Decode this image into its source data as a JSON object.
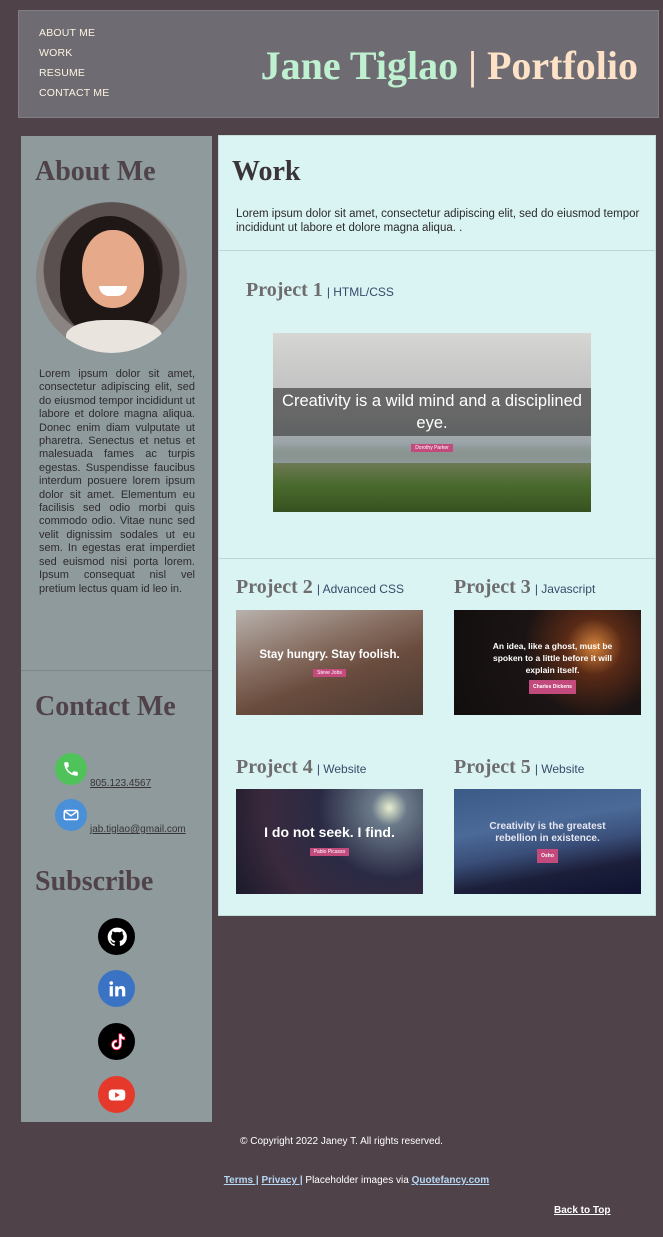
{
  "nav": {
    "items": [
      "ABOUT ME",
      "WORK",
      "RESUME",
      "CONTACT ME"
    ]
  },
  "brand": {
    "name": "Jane Tiglao",
    "separator": " | ",
    "suffix": "Portfolio"
  },
  "sidebar": {
    "about_heading": "About Me",
    "about_text": "Lorem ipsum dolor sit amet, consectetur adipiscing elit, sed do eiusmod tempor incididunt ut labore et dolore magna aliqua. Donec enim diam vulputate ut pharetra. Senectus et netus et malesuada fames ac turpis egestas. Suspendisse faucibus interdum posuere lorem ipsum dolor sit amet. Elementum eu facilisis sed odio morbi quis commodo odio. Vitae nunc sed velit dignissim sodales ut eu sem. In egestas erat imperdiet sed euismod nisi porta lorem. Ipsum consequat nisl vel pretium lectus quam id leo in.",
    "contact_heading": "Contact Me",
    "phone": "805.123.4567",
    "email": "jab.tiglao@gmail.com",
    "subscribe_heading": "Subscribe",
    "social": [
      {
        "icon": "github-icon",
        "color": "#000000"
      },
      {
        "icon": "linkedin-icon",
        "color": "#3b73c4"
      },
      {
        "icon": "tiktok-icon",
        "color": "#000000"
      },
      {
        "icon": "youtube-icon",
        "color": "#e53a2b"
      }
    ]
  },
  "work": {
    "heading": "Work",
    "intro": "Lorem ipsum dolor sit amet, consectetur adipiscing elit, sed do eiusmod tempor incididunt ut labore et dolore magna aliqua. .",
    "projects": [
      {
        "name": "Project 1",
        "tech": "| HTML/CSS",
        "quote": "Creativity is a wild mind and a disciplined eye.",
        "author": "Dorothy Parker"
      },
      {
        "name": "Project 2",
        "tech": "| Advanced CSS",
        "quote": "Stay hungry. Stay foolish.",
        "author": "Steve Jobs"
      },
      {
        "name": "Project 3",
        "tech": "| Javascript",
        "quote": "An idea, like a ghost, must be spoken to a little before it will explain itself.",
        "author": "Charles Dickens"
      },
      {
        "name": "Project 4",
        "tech": "| Website",
        "quote": "I do not seek. I find.",
        "author": "Pablo Picasso"
      },
      {
        "name": "Project 5",
        "tech": "| Website",
        "quote": "Creativity is the greatest rebellion in existence.",
        "author": "Osho"
      }
    ]
  },
  "footer": {
    "copyright": "© Copyright 2022 Janey T. All rights reserved.",
    "terms": "Terms |",
    "privacy": "Privacy |",
    "placeholder_text": " Placeholder images via ",
    "quotefancy": "Quotefancy.com",
    "back_to_top": "Back to Top"
  },
  "colors": {
    "background": "#4f4249",
    "header": "#6e6c72",
    "sidebar": "#8e9a9b",
    "main": "#d9f4f2",
    "brand_name": "#bff1d0",
    "brand_suffix": "#fde2c8"
  }
}
